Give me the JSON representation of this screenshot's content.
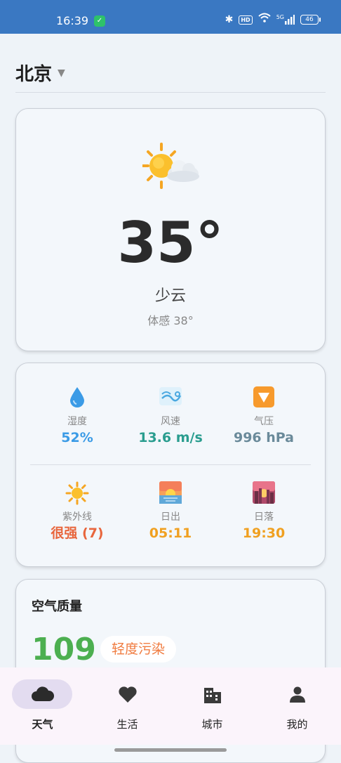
{
  "status_bar": {
    "time": "16:39",
    "hd_label": "HD",
    "signal_label": "5G",
    "battery": "46"
  },
  "header": {
    "city": "北京"
  },
  "weather": {
    "icon": "sun-behind-cloud-icon",
    "temperature": "35°",
    "condition": "少云",
    "feels_like": "体感 38°"
  },
  "details": [
    {
      "label": "湿度",
      "value": "52%",
      "icon": "droplet-icon",
      "color": "#3b9be6"
    },
    {
      "label": "风速",
      "value": "13.6 m/s",
      "icon": "wind-icon",
      "color": "#2a9d8f"
    },
    {
      "label": "气压",
      "value": "996 hPa",
      "icon": "pressure-icon",
      "color": "#6a8a9a"
    },
    {
      "label": "紫外线",
      "value": "很强 (7)",
      "icon": "sun-icon",
      "color": "#e8663d"
    },
    {
      "label": "日出",
      "value": "05:11",
      "icon": "sunrise-icon",
      "color": "#f0a020"
    },
    {
      "label": "日落",
      "value": "19:30",
      "icon": "sunset-icon",
      "color": "#f0a020"
    }
  ],
  "air_quality": {
    "title": "空气质量",
    "aqi": "109",
    "level": "轻度污染",
    "aqi_color": "#4caf50",
    "level_color": "#f07b3f"
  },
  "nav": [
    {
      "label": "天气",
      "icon": "cloud-icon",
      "active": true
    },
    {
      "label": "生活",
      "icon": "heart-icon",
      "active": false
    },
    {
      "label": "城市",
      "icon": "city-icon",
      "active": false
    },
    {
      "label": "我的",
      "icon": "person-icon",
      "active": false
    }
  ]
}
